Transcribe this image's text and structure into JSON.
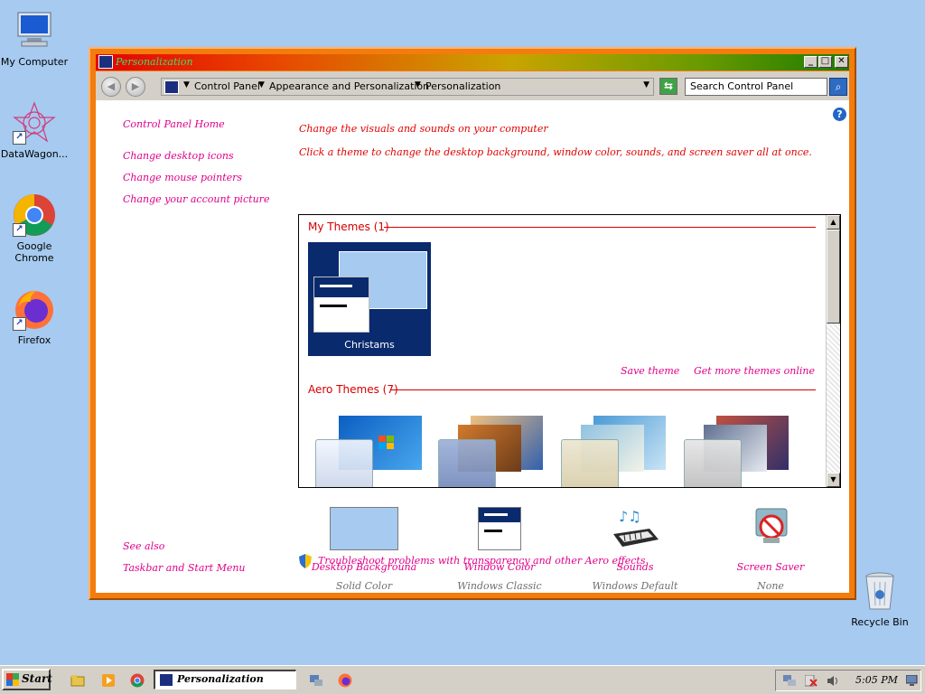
{
  "desktop": {
    "icons": [
      {
        "label": "My Computer",
        "icon": "computer-icon"
      },
      {
        "label": "DataWagon...",
        "icon": "datawagon-icon"
      },
      {
        "label": "Google Chrome",
        "icon": "chrome-icon"
      },
      {
        "label": "Firefox",
        "icon": "firefox-icon"
      },
      {
        "label": "Recycle Bin",
        "icon": "recycle-bin-icon"
      }
    ]
  },
  "window": {
    "title": "Personalization",
    "breadcrumbs": [
      "Control Panel",
      "Appearance and Personalization",
      "Personalization"
    ],
    "search_placeholder": "Search Control Panel"
  },
  "sidebar": {
    "home": "Control Panel Home",
    "links": [
      "Change desktop icons",
      "Change mouse pointers",
      "Change your account picture"
    ],
    "see_also": "See also",
    "see_also_links": [
      "Taskbar and Start Menu"
    ]
  },
  "main": {
    "heading": "Change the visuals and sounds on your computer",
    "subheading": "Click a theme to change the desktop background, window color, sounds, and screen saver all at once.",
    "my_themes": {
      "header": "My Themes (1)",
      "items": [
        {
          "name": "Christams"
        }
      ]
    },
    "save_theme": "Save theme",
    "get_more": "Get more themes online",
    "aero_themes": {
      "header": "Aero Themes (7)"
    },
    "options": [
      {
        "name": "Desktop Backgrouna",
        "value": "Solid Color"
      },
      {
        "name": "Window Color",
        "value": "Windows Classic"
      },
      {
        "name": "Sounds",
        "value": "Windows Default"
      },
      {
        "name": "Screen Saver",
        "value": "None"
      }
    ],
    "troubleshoot": "Troubleshoot problems with transparency and other Aero effects"
  },
  "taskbar": {
    "start_label": "Start",
    "task_label": "Personalization",
    "clock": "5:05 PM"
  },
  "colors": {
    "desktop_bg": "#a6caf0",
    "window_frame": "#f47c0c",
    "link_magenta": "#e0008a",
    "heading_red": "#e00000",
    "theme_tile_bg": "#0a2a6e"
  }
}
